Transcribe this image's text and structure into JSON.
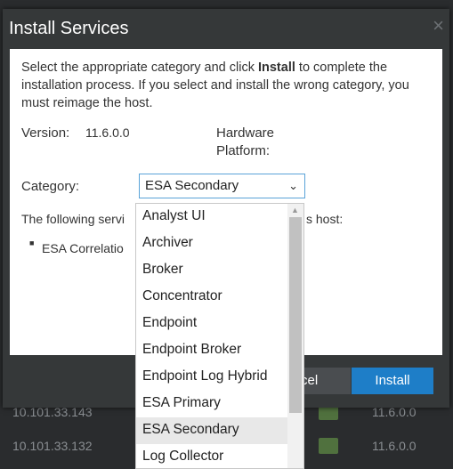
{
  "dialog": {
    "title": "Install Services",
    "close_glyph": "×",
    "intro_before": "Select the appropriate category and click ",
    "intro_bold": "Install",
    "intro_after": " to complete the installation process. If you select and install the wrong category, you must reimage the host.",
    "version_label": "Version:",
    "version_value": "11.6.0.0",
    "hardware_label_line1": "Hardware",
    "hardware_label_line2": "Platform:",
    "category_label": "Category:",
    "category_selected": "ESA Secondary",
    "following_text_left": "The following servi",
    "following_text_right": "s host:",
    "service_bullet": "ESA Correlatio",
    "cancel_label": "cel",
    "install_label": "Install"
  },
  "dropdown": {
    "options": [
      "Analyst UI",
      "Archiver",
      "Broker",
      "Concentrator",
      "Endpoint",
      "Endpoint Broker",
      "Endpoint Log Hybrid",
      "ESA Primary",
      "ESA Secondary",
      "Log Collector"
    ]
  },
  "backdrop": {
    "rows": [
      {
        "ip": "10.101.33.143",
        "version": "11.6.0.0"
      },
      {
        "ip": "10.101.33.132",
        "version": "11.6.0.0"
      }
    ]
  }
}
